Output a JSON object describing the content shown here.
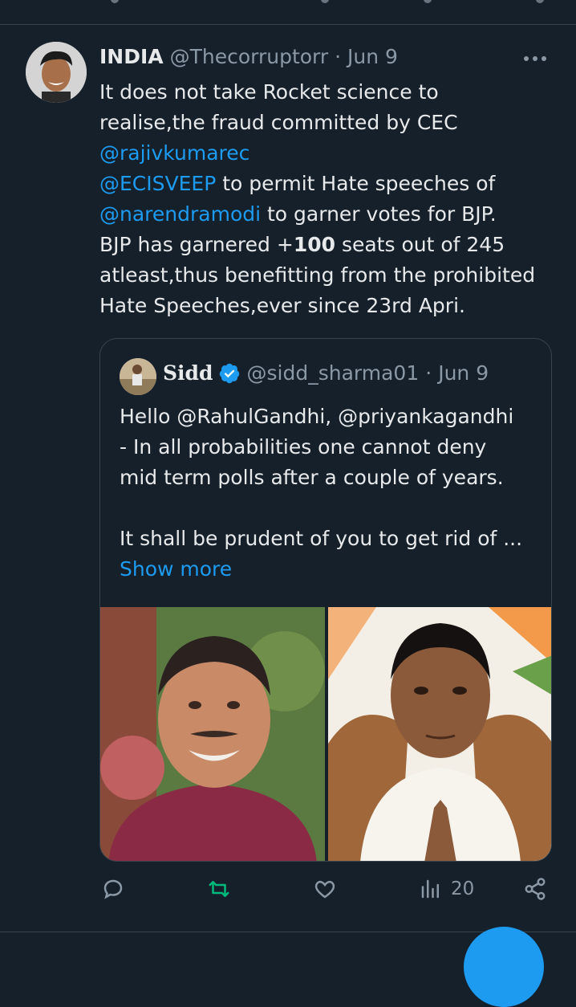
{
  "tweet": {
    "author_name": "INDIA",
    "handle": "@Thecorruptorr",
    "separator": "·",
    "date": "Jun 9",
    "lines": [
      {
        "pre": "It does not take Rocket science to",
        "mention": "",
        "post": ""
      },
      {
        "pre": "realise,the fraud committed by CEC",
        "mention": "",
        "post": ""
      },
      {
        "pre": "",
        "mention": "@rajivkumarec",
        "post": ""
      },
      {
        "pre": "",
        "mention": "@ECISVEEP",
        "post": " to permit Hate speeches of"
      },
      {
        "pre": "",
        "mention": "@narendramodi",
        "post": " to garner votes for BJP."
      }
    ],
    "line6_pre": "BJP has garnered +",
    "line6_bold": "100",
    "line6_post": " seats out of 245",
    "line7": "atleast,thus benefitting from the prohibited",
    "line8": "Hate Speeches,ever since 23rd Apri."
  },
  "quote": {
    "author_name": "Sidd",
    "handle": "@sidd_sharma01",
    "separator": "·",
    "date": "Jun 9",
    "lines": [
      "Hello @RahulGandhi, @priyankagandhi",
      "- In all probabilities one cannot deny",
      "mid term polls after a couple of years.",
      "",
      "It shall be prudent of you to get rid of ..."
    ],
    "show_more": "Show more"
  },
  "actions": {
    "views": "20"
  },
  "colors": {
    "background": "#15202b",
    "link": "#1d9bf0",
    "muted": "#8b98a5",
    "retweet": "#00ba7c"
  },
  "icons": [
    "reply-icon",
    "retweet-icon",
    "like-icon",
    "views-icon",
    "share-icon",
    "more-icon",
    "verified-icon"
  ]
}
